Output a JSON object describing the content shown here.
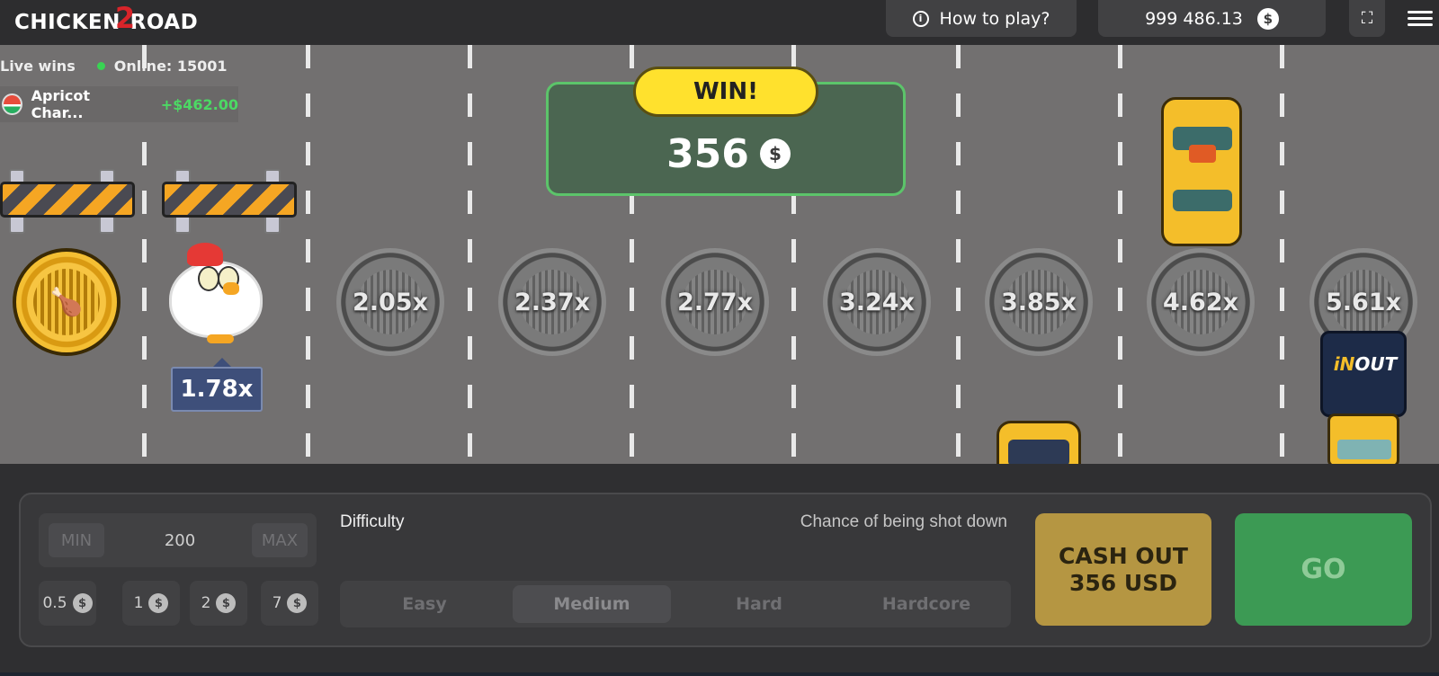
{
  "header": {
    "logo_left": "CHICKEN",
    "logo_num": "2",
    "logo_right": "ROAD",
    "how_to_play": "How to play?",
    "balance": "999 486.13",
    "currency_icon": "$"
  },
  "live": {
    "label": "Live wins",
    "online": "Online: 15001",
    "last_win_user": "Apricot Char...",
    "last_win_amount": "+$462.00"
  },
  "game": {
    "current_multiplier": "1.78x",
    "multipliers": [
      "2.05x",
      "2.37x",
      "2.77x",
      "3.24x",
      "3.85x",
      "4.62x",
      "5.61x"
    ],
    "win_title": "WIN!",
    "win_amount": "356",
    "truck_brand_a": "iN",
    "truck_brand_b": "OUT"
  },
  "controls": {
    "min_label": "MIN",
    "max_label": "MAX",
    "bet_value": "200",
    "chips": [
      "0.5",
      "1",
      "2",
      "7"
    ],
    "difficulty_label": "Difficulty",
    "chance_label": "Chance of being shot down",
    "difficulties": [
      "Easy",
      "Medium",
      "Hard",
      "Hardcore"
    ],
    "active_difficulty": "Medium",
    "cashout_line1": "CASH OUT",
    "cashout_line2": "356 USD",
    "go_label": "GO"
  }
}
